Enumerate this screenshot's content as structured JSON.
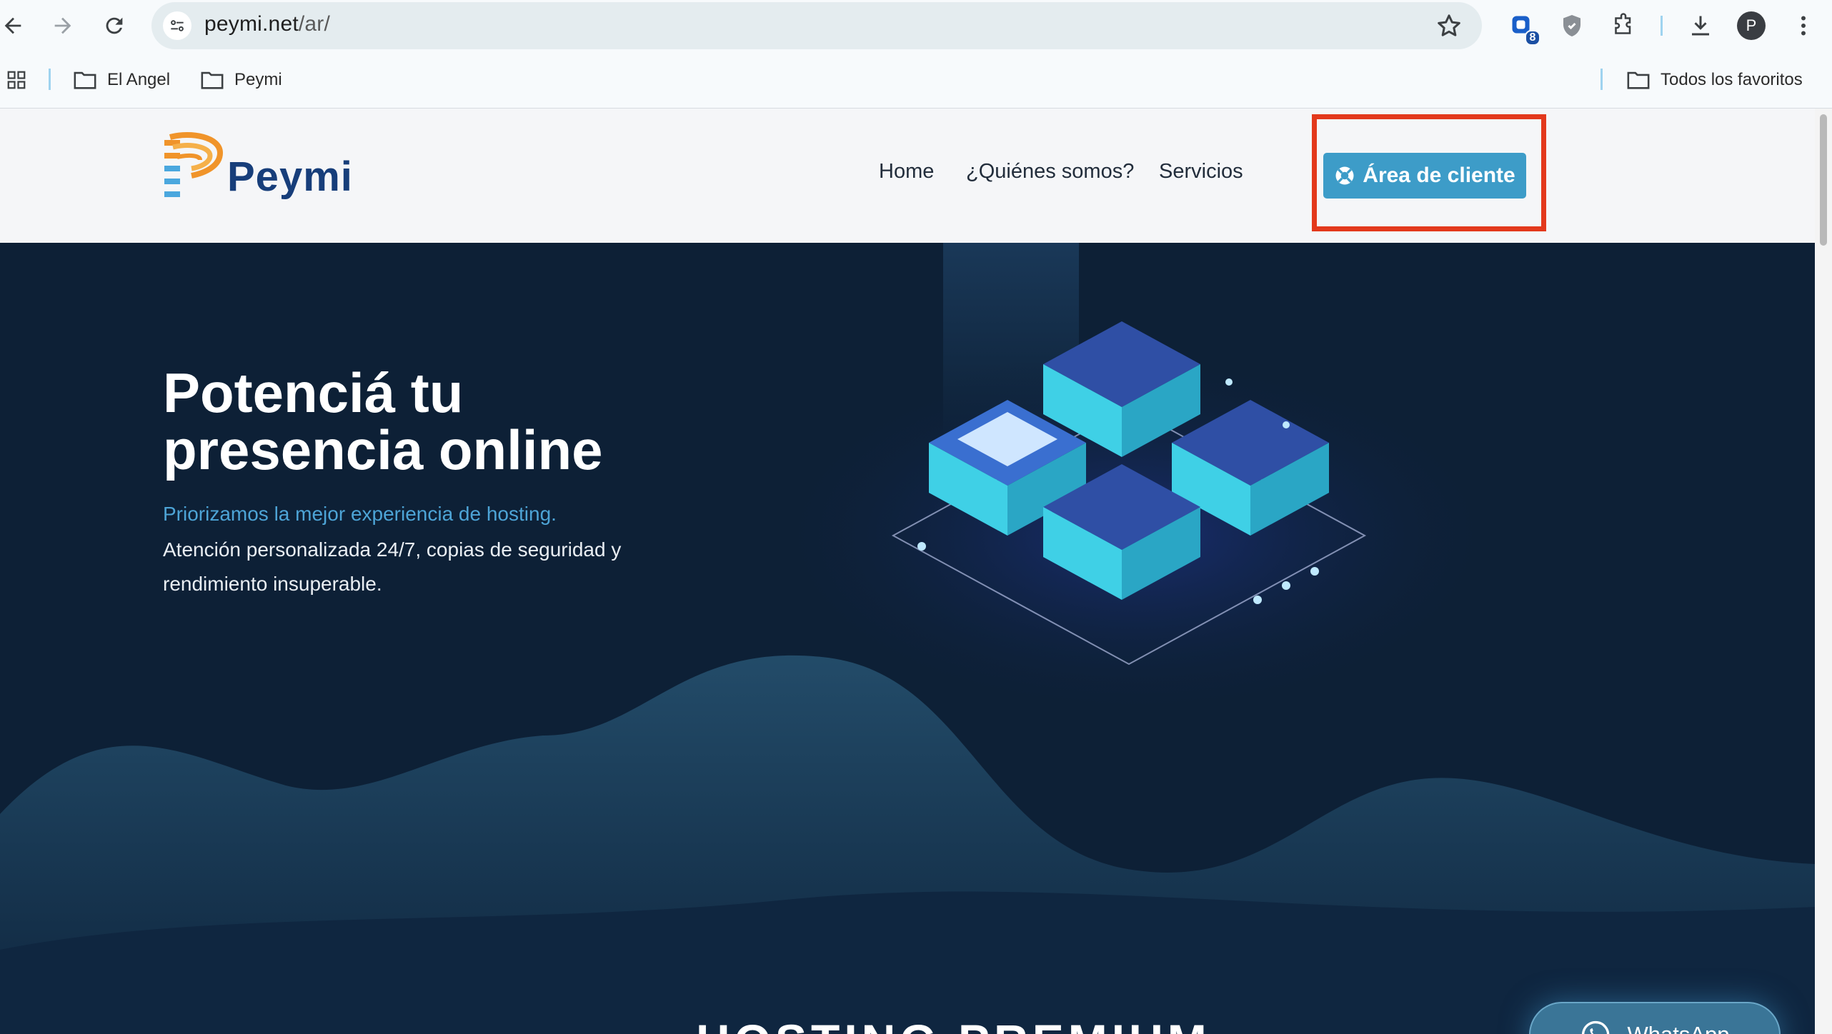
{
  "browser": {
    "url_host": "peymi.net",
    "url_path": "/ar/",
    "extension_badge": "8",
    "profile_initial": "P",
    "bookmarks": [
      {
        "label": "El Angel"
      },
      {
        "label": "Peymi"
      }
    ],
    "all_bookmarks_label": "Todos los favoritos"
  },
  "site": {
    "logo_text": "Peymi",
    "nav": [
      {
        "label": "Home"
      },
      {
        "label": "¿Quiénes somos?"
      },
      {
        "label": "Servicios"
      }
    ],
    "cta_label": "Área de cliente"
  },
  "hero": {
    "title_line1": "Potenciá tu",
    "title_line2": "presencia online",
    "tagline": "Priorizamos la mejor experiencia de hosting.",
    "description": "Atención personalizada 24/7, copias de seguridad y rendimiento insuperable."
  },
  "section": {
    "heading": "HOSTING PREMIUM"
  },
  "whatsapp": {
    "label": "WhatsApp"
  },
  "colors": {
    "accent": "#3d9cc8",
    "tagline": "#4da4d6",
    "hero_bg": "#0d2036",
    "highlight": "#e3391c",
    "logo_blue": "#173e7a",
    "logo_orange": "#f0942a"
  }
}
